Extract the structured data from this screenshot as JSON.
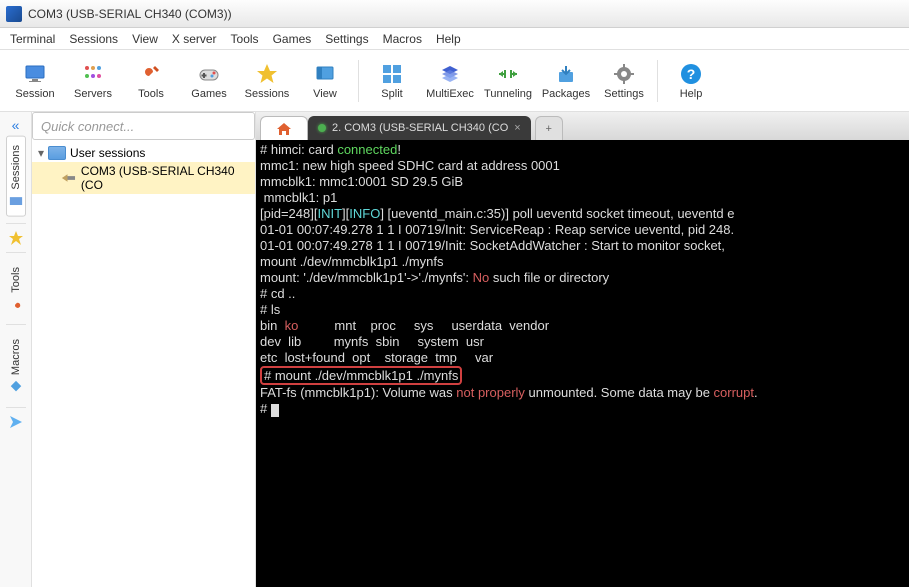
{
  "window": {
    "title": "COM3  (USB-SERIAL CH340 (COM3))"
  },
  "menu": [
    "Terminal",
    "Sessions",
    "View",
    "X server",
    "Tools",
    "Games",
    "Settings",
    "Macros",
    "Help"
  ],
  "toolbar": [
    {
      "label": "Session",
      "icon": "monitor"
    },
    {
      "label": "Servers",
      "icon": "grid"
    },
    {
      "label": "Tools",
      "icon": "wrench"
    },
    {
      "label": "Games",
      "icon": "gamepad"
    },
    {
      "label": "Sessions",
      "icon": "star"
    },
    {
      "label": "View",
      "icon": "view"
    },
    {
      "label": "Split",
      "icon": "split"
    },
    {
      "label": "MultiExec",
      "icon": "multi"
    },
    {
      "label": "Tunneling",
      "icon": "tunnel"
    },
    {
      "label": "Packages",
      "icon": "pkg"
    },
    {
      "label": "Settings",
      "icon": "gear"
    },
    {
      "label": "Help",
      "icon": "help"
    }
  ],
  "quick_connect_placeholder": "Quick connect...",
  "left_tabs": {
    "sessions": "Sessions",
    "tools": "Tools",
    "macros": "Macros"
  },
  "tree": {
    "root": "User sessions",
    "item": "COM3  (USB-SERIAL CH340 (CO"
  },
  "tabs": {
    "active": "2. COM3  (USB-SERIAL CH340 (CO",
    "close": "×",
    "new": "+"
  },
  "term": {
    "l1a": "# himci: card ",
    "l1b": "connected",
    "l1c": "!",
    "l2": "mmc1: new high speed SDHC card at address 0001",
    "l3": "mmcblk1: mmc1:0001 SD 29.5 GiB",
    "l4": " mmcblk1: p1",
    "l5a": "[pid=248][",
    "l5b": "INIT",
    "l5c": "][",
    "l5d": "INFO",
    "l5e": "] [ueventd_main.c:35)] poll ueventd socket timeout, ueventd e",
    "l6": "01-01 00:07:49.278 1 1 I 00719/Init: ServiceReap : Reap service ueventd, pid 248.",
    "l7": "01-01 00:07:49.278 1 1 I 00719/Init: SocketAddWatcher : Start to monitor socket, ",
    "l8": "mount ./dev/mmcblk1p1 ./mynfs",
    "l9a": "mount: './dev/mmcblk1p1'->'./mynfs': ",
    "l9b": "No",
    "l9c": " such file or directory",
    "l10": "# cd ..",
    "l11": "# ls",
    "l12a": "bin  ",
    "l12b": "ko",
    "l12c": "          mnt    proc     sys     userdata  vendor",
    "l13": "dev  lib         mynfs  sbin     system  usr",
    "l14": "etc  lost+found  opt    storage  tmp     var",
    "l15": "# mount ./dev/mmcblk1p1 ./mynfs",
    "l16a": "FAT-fs (mmcblk1p1): Volume was ",
    "l16b": "not properly",
    "l16c": " unmounted. Some data may be ",
    "l16d": "corrupt",
    "l16e": ".",
    "l17": "# "
  }
}
